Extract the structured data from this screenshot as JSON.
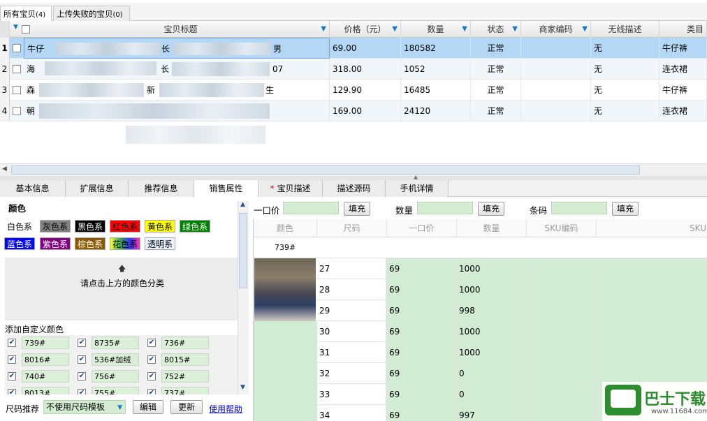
{
  "top_tabs": [
    {
      "label": "所有宝贝",
      "count": "(4)"
    },
    {
      "label": "上传失败的宝贝",
      "count": "(0)"
    }
  ],
  "grid": {
    "headers": [
      "宝贝标题",
      "价格（元）",
      "数量",
      "状态",
      "商家编码",
      "无线描述",
      "类目"
    ],
    "rows": [
      {
        "n": "1",
        "title_start": "牛仔",
        "title_mid": "长",
        "title_end": "男",
        "price": "69.00",
        "qty": "180582",
        "status": "正常",
        "code": "",
        "wireless": "无",
        "cat": "牛仔裤"
      },
      {
        "n": "2",
        "title_start": "海",
        "title_mid": "长",
        "title_end": "07",
        "price": "318.00",
        "qty": "1052",
        "status": "正常",
        "code": "",
        "wireless": "无",
        "cat": "连衣裙"
      },
      {
        "n": "3",
        "title_start": "森",
        "title_mid": "新",
        "title_end": "生",
        "price": "129.90",
        "qty": "16485",
        "status": "正常",
        "code": "",
        "wireless": "无",
        "cat": "牛仔裤"
      },
      {
        "n": "4",
        "title_start": "朝",
        "title_mid": "",
        "title_end": "",
        "price": "169.00",
        "qty": "24120",
        "status": "正常",
        "code": "",
        "wireless": "无",
        "cat": "连衣裙"
      }
    ]
  },
  "detail_tabs": [
    "基本信息",
    "扩展信息",
    "推荐信息",
    "销售属性",
    "宝贝描述",
    "描述源码",
    "手机详情"
  ],
  "colors": {
    "title": "颜色",
    "chips": [
      {
        "label": "白色系",
        "bg": "#ffffff",
        "fg": "#000000"
      },
      {
        "label": "灰色系",
        "bg": "#808080",
        "fg": "#000000"
      },
      {
        "label": "黑色系",
        "bg": "#000000",
        "fg": "#ffffff"
      },
      {
        "label": "红色系",
        "bg": "#ff0000",
        "fg": "#000000"
      },
      {
        "label": "黄色系",
        "bg": "#ffff00",
        "fg": "#000000"
      },
      {
        "label": "绿色系",
        "bg": "#008000",
        "fg": "#ffffff"
      },
      {
        "label": "蓝色系",
        "bg": "#0000ff",
        "fg": "#ffffff"
      },
      {
        "label": "紫色系",
        "bg": "#800080",
        "fg": "#ffffff"
      },
      {
        "label": "棕色系",
        "bg": "#8b5a00",
        "fg": "#ffffff"
      },
      {
        "label": "花色系",
        "bg": "#33aa55",
        "fg": "#000000"
      },
      {
        "label": "透明系",
        "bg": "#eaf2ff",
        "fg": "#000000"
      }
    ],
    "hint": "请点击上方的颜色分类",
    "custom_title": "添加自定义颜色",
    "custom": [
      [
        "739#",
        "8735#",
        "736#"
      ],
      [
        "8016#",
        "536#加绒",
        "8015#"
      ],
      [
        "740#",
        "756#",
        "752#"
      ],
      [
        "8013#",
        "755#",
        "737#"
      ]
    ]
  },
  "size_bar": {
    "label": "尺码推荐",
    "select": "不使用尺码模板",
    "edit": "编辑",
    "update": "更新",
    "help": "使用帮助"
  },
  "fill_row": [
    {
      "label": "一口价",
      "btn": "填充"
    },
    {
      "label": "数量",
      "btn": "填充"
    },
    {
      "label": "条码",
      "btn": "填充"
    }
  ],
  "sku": {
    "headers": [
      "颜色",
      "尺码",
      "一口价",
      "数量",
      "SKU编码",
      "SKU"
    ],
    "group": "739#",
    "rows": [
      {
        "size": "27",
        "price": "69",
        "qty": "1000"
      },
      {
        "size": "28",
        "price": "69",
        "qty": "1000"
      },
      {
        "size": "29",
        "price": "69",
        "qty": "998"
      },
      {
        "size": "30",
        "price": "69",
        "qty": "1000"
      },
      {
        "size": "31",
        "price": "69",
        "qty": "1000"
      },
      {
        "size": "32",
        "price": "69",
        "qty": "0"
      },
      {
        "size": "33",
        "price": "69",
        "qty": "0"
      },
      {
        "size": "34",
        "price": "69",
        "qty": "997"
      }
    ]
  },
  "watermark": {
    "title": "巴士下载",
    "site": "www.11684.com"
  }
}
